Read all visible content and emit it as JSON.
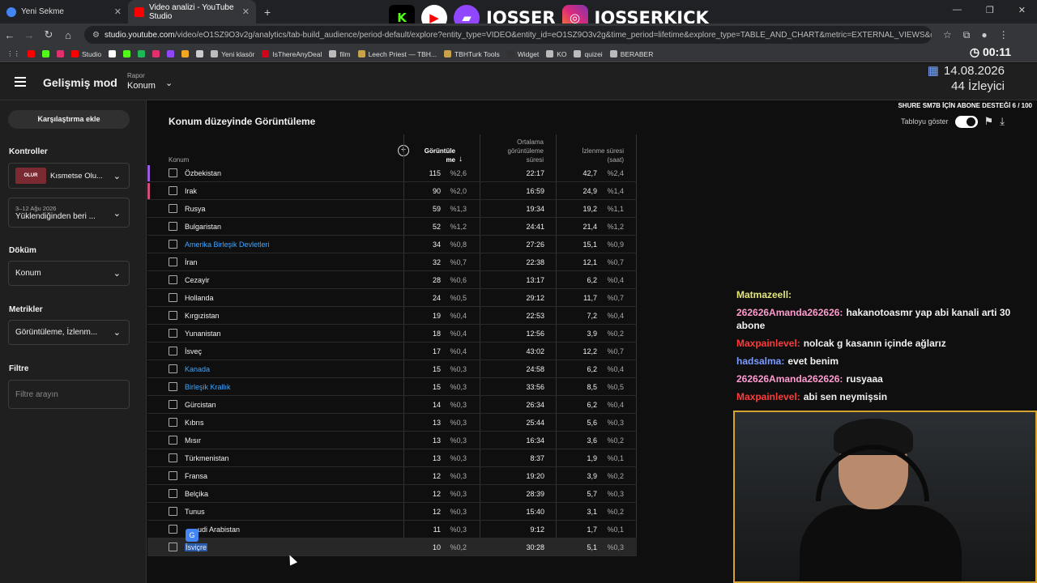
{
  "browser": {
    "tabs": [
      {
        "label": "Yeni Sekme",
        "color": "#4285f4"
      },
      {
        "label": "Video analizi - YouTube Studio",
        "color": "#ff0000"
      }
    ],
    "url_host": "studio.youtube.com",
    "url_path": "/video/eO1SZ9O3v2g/analytics/tab-build_audience/period-default/explore?entity_type=VIDEO&entity_id=eO1SZ9O3v2g&time_period=lifetime&explore_type=TABLE_AND_CHART&metric=EXTERNAL_VIEWS&granular...",
    "bookmarks": [
      {
        "label": "",
        "color": "#ff0000"
      },
      {
        "label": "",
        "color": "#53fc18"
      },
      {
        "label": "",
        "color": "#e1306c"
      },
      {
        "label": "Studio",
        "color": "#ff0000"
      },
      {
        "label": "",
        "color": "#ffffff"
      },
      {
        "label": "",
        "color": "#53fc18"
      },
      {
        "label": "",
        "color": "#1db954"
      },
      {
        "label": "",
        "color": "#e1306c"
      },
      {
        "label": "",
        "color": "#9146ff"
      },
      {
        "label": "",
        "color": "#f5a623"
      },
      {
        "label": "",
        "color": "#cccccc"
      },
      {
        "label": "Yeni klasör",
        "color": "#bbbbbb"
      },
      {
        "label": "IsThereAnyDeal",
        "color": "#d0021b"
      },
      {
        "label": "film",
        "color": "#bbbbbb"
      },
      {
        "label": "Leech Priest — TBH...",
        "color": "#c8a24a"
      },
      {
        "label": "TBHTurk Tools",
        "color": "#c8a24a"
      },
      {
        "label": "Widget",
        "color": "#333333"
      },
      {
        "label": "KO",
        "color": "#bbbbbb"
      },
      {
        "label": "quizei",
        "color": "#bbbbbb"
      },
      {
        "label": "BERABER",
        "color": "#bbbbbb"
      }
    ]
  },
  "stream": {
    "brand1": "JOSSER",
    "brand2": "JOSSERKICK",
    "clock": "00:11",
    "date": "14.08.2026",
    "viewers": "44 İzleyici",
    "goal": "SHURE SM7B İÇİN ABONE DESTEĞİ 6 / 100"
  },
  "header": {
    "title": "Gelişmiş mod",
    "report_caption": "Rapor",
    "report_value": "Konum"
  },
  "sidebar": {
    "compare_button": "Karşılaştırma ekle",
    "controls_heading": "Kontroller",
    "video_label": "Kısmetse Olu...",
    "date_range_small": "3–12 Ağu 2026",
    "date_range": "Yüklendiğinden beri ...",
    "breakdown_heading": "Döküm",
    "breakdown_value": "Konum",
    "metrics_heading": "Metrikler",
    "metrics_value": "Görüntüleme, İzlenm...",
    "filter_heading": "Filtre",
    "filter_placeholder": "Filtre arayın"
  },
  "main": {
    "title": "Konum düzeyinde Görüntüleme",
    "toggle_label": "Tabloyu göster",
    "columns": {
      "location": "Konum",
      "views_1": "Görüntüle",
      "views_2": "me",
      "avg_1": "Ortalama",
      "avg_2": "görüntüleme",
      "avg_3": "süresi",
      "watch_1": "İzlenme süresi",
      "watch_2": "(saat)"
    },
    "rows": [
      {
        "name": "Özbekistan",
        "views": "115",
        "vpct": "%2,6",
        "avg": "22:17",
        "watch": "42,7",
        "wpct": "%2,4",
        "link": false
      },
      {
        "name": "Irak",
        "views": "90",
        "vpct": "%2,0",
        "avg": "16:59",
        "watch": "24,9",
        "wpct": "%1,4",
        "link": false
      },
      {
        "name": "Rusya",
        "views": "59",
        "vpct": "%1,3",
        "avg": "19:34",
        "watch": "19,2",
        "wpct": "%1,1",
        "link": false
      },
      {
        "name": "Bulgaristan",
        "views": "52",
        "vpct": "%1,2",
        "avg": "24:41",
        "watch": "21,4",
        "wpct": "%1,2",
        "link": false
      },
      {
        "name": "Amerika Birleşik Devletleri",
        "views": "34",
        "vpct": "%0,8",
        "avg": "27:26",
        "watch": "15,1",
        "wpct": "%0,9",
        "link": true
      },
      {
        "name": "İran",
        "views": "32",
        "vpct": "%0,7",
        "avg": "22:38",
        "watch": "12,1",
        "wpct": "%0,7",
        "link": false
      },
      {
        "name": "Cezayir",
        "views": "28",
        "vpct": "%0,6",
        "avg": "13:17",
        "watch": "6,2",
        "wpct": "%0,4",
        "link": false
      },
      {
        "name": "Hollanda",
        "views": "24",
        "vpct": "%0,5",
        "avg": "29:12",
        "watch": "11,7",
        "wpct": "%0,7",
        "link": false
      },
      {
        "name": "Kırgızistan",
        "views": "19",
        "vpct": "%0,4",
        "avg": "22:53",
        "watch": "7,2",
        "wpct": "%0,4",
        "link": false
      },
      {
        "name": "Yunanistan",
        "views": "18",
        "vpct": "%0,4",
        "avg": "12:56",
        "watch": "3,9",
        "wpct": "%0,2",
        "link": false
      },
      {
        "name": "İsveç",
        "views": "17",
        "vpct": "%0,4",
        "avg": "43:02",
        "watch": "12,2",
        "wpct": "%0,7",
        "link": false
      },
      {
        "name": "Kanada",
        "views": "15",
        "vpct": "%0,3",
        "avg": "24:58",
        "watch": "6,2",
        "wpct": "%0,4",
        "link": true
      },
      {
        "name": "Birleşik Krallık",
        "views": "15",
        "vpct": "%0,3",
        "avg": "33:56",
        "watch": "8,5",
        "wpct": "%0,5",
        "link": true
      },
      {
        "name": "Gürcistan",
        "views": "14",
        "vpct": "%0,3",
        "avg": "26:34",
        "watch": "6,2",
        "wpct": "%0,4",
        "link": false
      },
      {
        "name": "Kıbrıs",
        "views": "13",
        "vpct": "%0,3",
        "avg": "25:44",
        "watch": "5,6",
        "wpct": "%0,3",
        "link": false
      },
      {
        "name": "Mısır",
        "views": "13",
        "vpct": "%0,3",
        "avg": "16:34",
        "watch": "3,6",
        "wpct": "%0,2",
        "link": false
      },
      {
        "name": "Türkmenistan",
        "views": "13",
        "vpct": "%0,3",
        "avg": "8:37",
        "watch": "1,9",
        "wpct": "%0,1",
        "link": false
      },
      {
        "name": "Fransa",
        "views": "12",
        "vpct": "%0,3",
        "avg": "19:20",
        "watch": "3,9",
        "wpct": "%0,2",
        "link": false
      },
      {
        "name": "Belçika",
        "views": "12",
        "vpct": "%0,3",
        "avg": "28:39",
        "watch": "5,7",
        "wpct": "%0,3",
        "link": false
      },
      {
        "name": "Tunus",
        "views": "12",
        "vpct": "%0,3",
        "avg": "15:40",
        "watch": "3,1",
        "wpct": "%0,2",
        "link": false
      },
      {
        "name": "udi Arabistan",
        "views": "11",
        "vpct": "%0,3",
        "avg": "9:12",
        "watch": "1,7",
        "wpct": "%0,1",
        "link": false
      },
      {
        "name": "İsviçre",
        "views": "10",
        "vpct": "%0,2",
        "avg": "30:28",
        "watch": "5,1",
        "wpct": "%0,3",
        "link": false
      }
    ]
  },
  "chat": [
    {
      "user": "Matmazeell:",
      "text": "",
      "color": "#e6e67a"
    },
    {
      "user": "262626Amanda262626:",
      "text": "hakanotoasmr yap abi kanali arti 30 abone",
      "color": "#ff9bd0"
    },
    {
      "user": "Maxpainlevel:",
      "text": "nolcak g kasanın içinde ağlarız",
      "color": "#ff3b3b"
    },
    {
      "user": "hadsalma:",
      "text": "evet benim",
      "color": "#7b9bff"
    },
    {
      "user": "262626Amanda262626:",
      "text": "rusyaaa",
      "color": "#ff9bd0"
    },
    {
      "user": "Maxpainlevel:",
      "text": "abi sen neymişsin",
      "color": "#ff3b3b"
    }
  ]
}
